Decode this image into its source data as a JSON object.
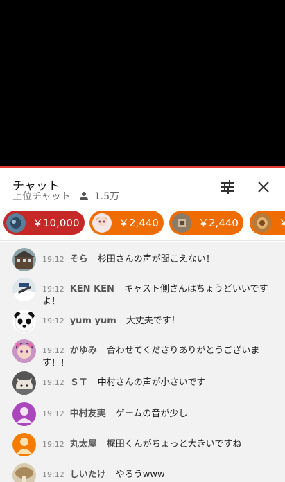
{
  "header": {
    "title": "チャット",
    "mode": "上位チャット",
    "viewers": "1.5万"
  },
  "super_chats": [
    {
      "amount": "￥10,000",
      "color": "#c62828"
    },
    {
      "amount": "￥2,440",
      "color": "#ef6c00"
    },
    {
      "amount": "￥2,440",
      "color": "#ef6c00"
    },
    {
      "amount": "￥",
      "color": "#ef6c00"
    }
  ],
  "messages": [
    {
      "time": "19:12",
      "author": "そら",
      "text": "杉田さんの声が聞こえない！"
    },
    {
      "time": "19:12",
      "author": "KEN KEN",
      "text": "キャスト側さんはちょうどいいですよ！"
    },
    {
      "time": "19:12",
      "author": "yum yum",
      "text": "大丈夫です！"
    },
    {
      "time": "19:12",
      "author": "かゆみ",
      "text": "合わせてくださりありがとうございます！！"
    },
    {
      "time": "19:12",
      "author": "ＳＴ",
      "text": "中村さんの声が小さいです"
    },
    {
      "time": "19:12",
      "author": "中村友実",
      "text": "ゲームの音が少し"
    },
    {
      "time": "19:12",
      "author": "丸太屋",
      "text": "梶田くんがちょっと大きいですね"
    },
    {
      "time": "19:12",
      "author": "しいたけ",
      "text": "やろうwww"
    }
  ],
  "colors": {
    "accent_red": "#e53935",
    "superchat_red": "#c62828",
    "superchat_orange": "#ef6c00"
  }
}
